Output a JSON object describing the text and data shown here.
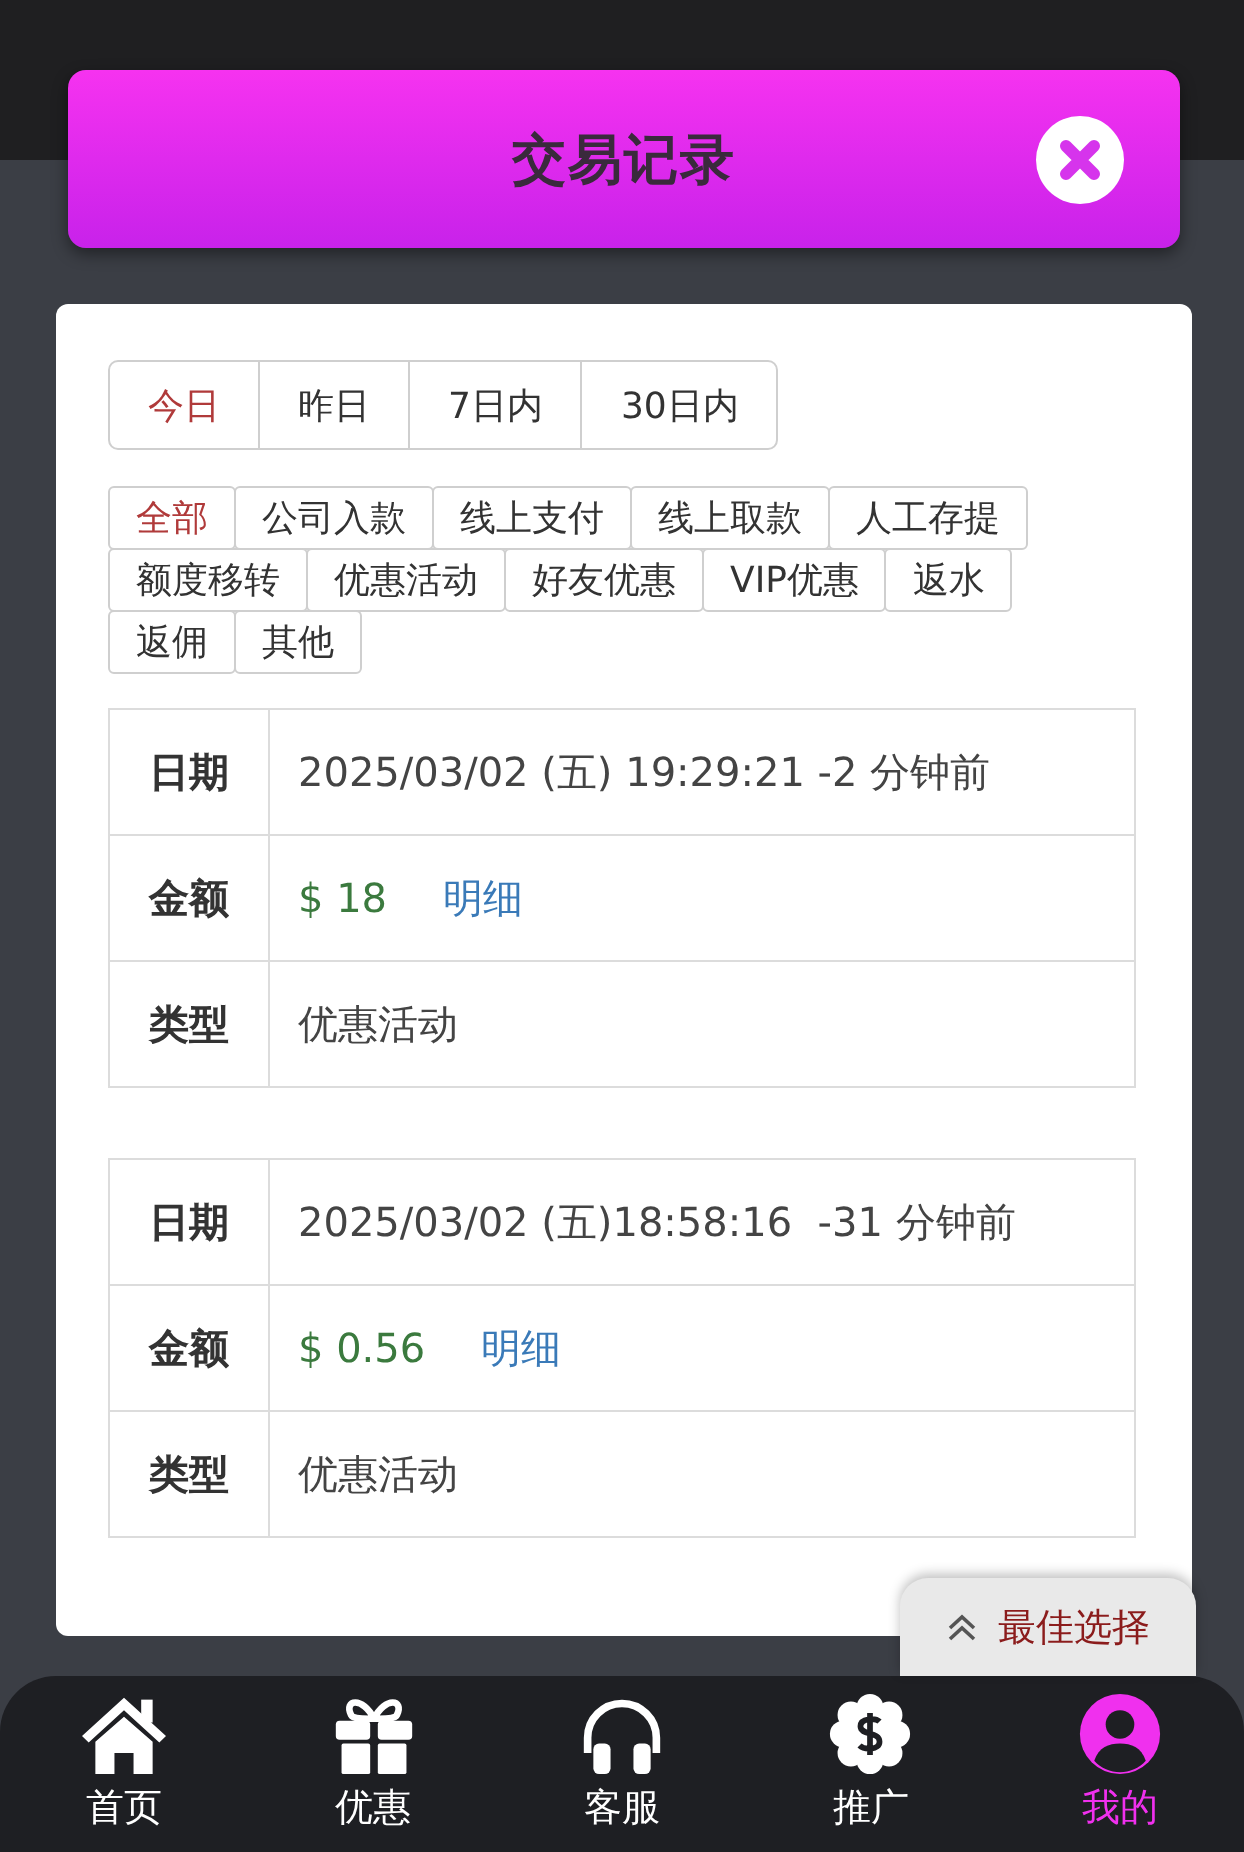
{
  "header": {
    "title": "交易记录"
  },
  "date_tabs": [
    {
      "label": "今日",
      "selected": true
    },
    {
      "label": "昨日",
      "selected": false
    },
    {
      "label": "7日内",
      "selected": false
    },
    {
      "label": "30日内",
      "selected": false
    }
  ],
  "categories": [
    {
      "label": "全部",
      "selected": true
    },
    {
      "label": "公司入款",
      "selected": false
    },
    {
      "label": "线上支付",
      "selected": false
    },
    {
      "label": "线上取款",
      "selected": false
    },
    {
      "label": "人工存提",
      "selected": false
    },
    {
      "label": "额度移转",
      "selected": false
    },
    {
      "label": "优惠活动",
      "selected": false
    },
    {
      "label": "好友优惠",
      "selected": false
    },
    {
      "label": "VIP优惠",
      "selected": false
    },
    {
      "label": "返水",
      "selected": false
    },
    {
      "label": "返佣",
      "selected": false
    },
    {
      "label": "其他",
      "selected": false
    }
  ],
  "records": [
    {
      "rows": [
        {
          "kind": "text",
          "label": "日期",
          "value": "2025/03/02 (五) 19:29:21 -2 分钟前"
        },
        {
          "kind": "amount",
          "label": "金额",
          "value": "$ 18",
          "link": "明细"
        },
        {
          "kind": "text",
          "label": "类型",
          "value": "优惠活动"
        }
      ]
    },
    {
      "rows": [
        {
          "kind": "text",
          "label": "日期",
          "value": "2025/03/02 (五)18:58:16  -31 分钟前"
        },
        {
          "kind": "amount",
          "label": "金额",
          "value": "$ 0.56",
          "link": "明细"
        },
        {
          "kind": "text",
          "label": "类型",
          "value": "优惠活动"
        }
      ]
    }
  ],
  "float_button": {
    "label": "最佳选择"
  },
  "nav": [
    {
      "kind": "home",
      "label": "首页",
      "selected": false
    },
    {
      "kind": "gift",
      "label": "优惠",
      "selected": false
    },
    {
      "kind": "headset",
      "label": "客服",
      "selected": false
    },
    {
      "kind": "badge",
      "label": "推广",
      "selected": false
    },
    {
      "kind": "user",
      "label": "我的",
      "selected": true
    }
  ]
}
